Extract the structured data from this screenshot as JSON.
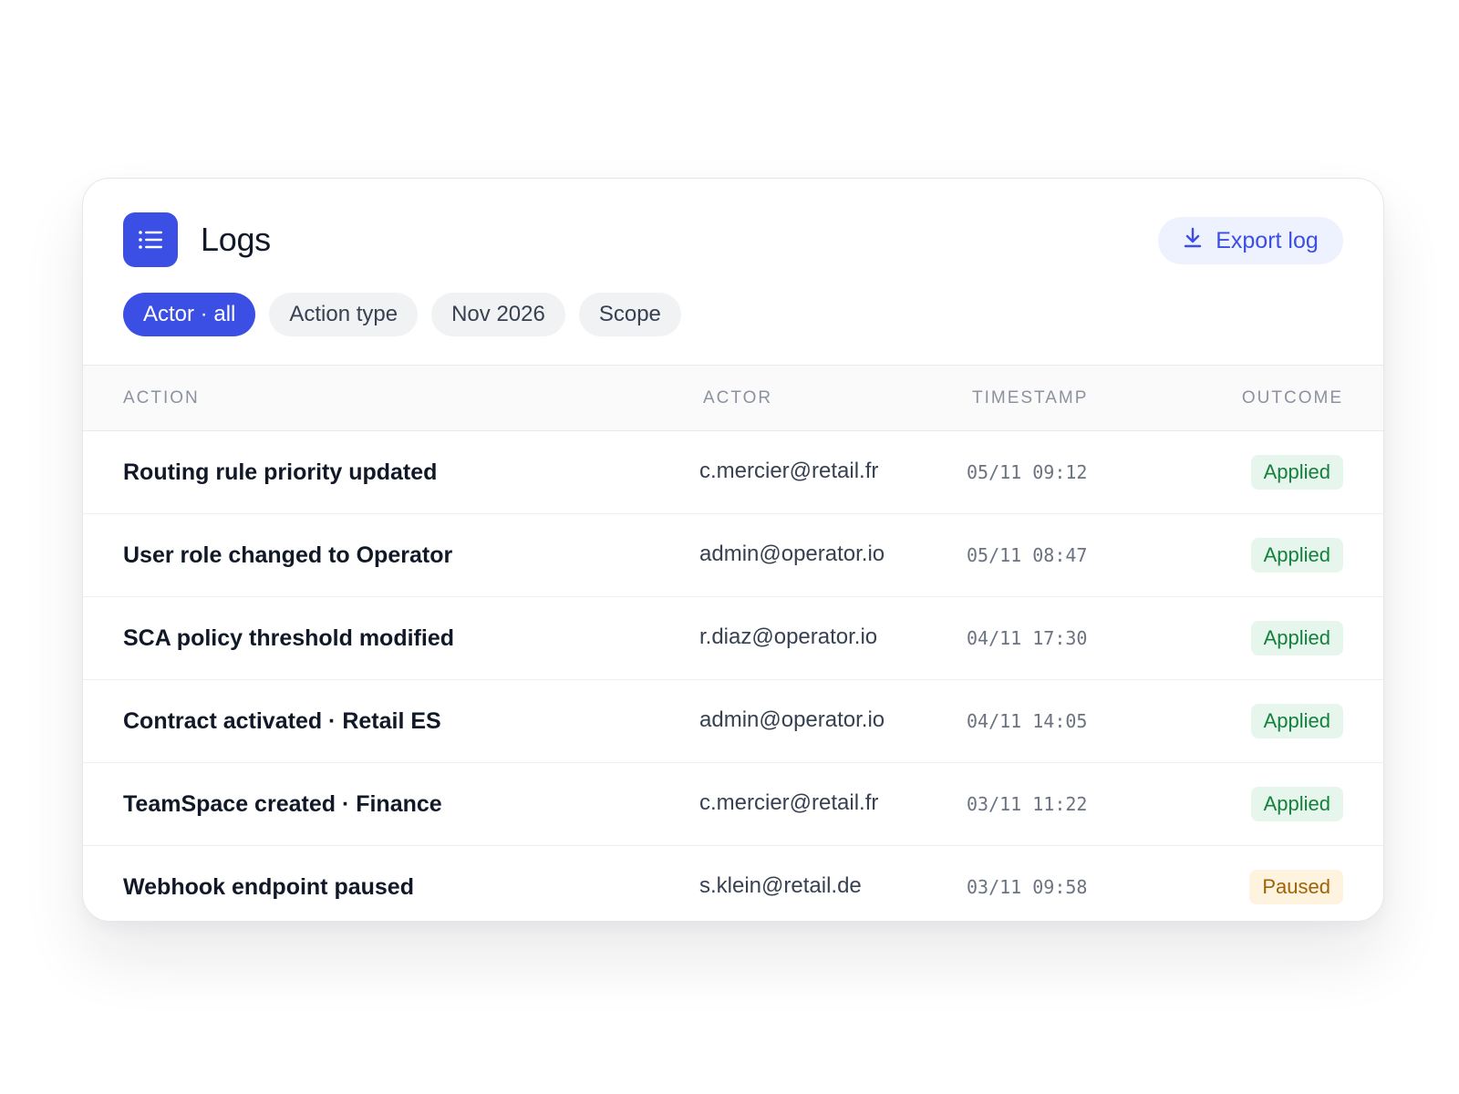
{
  "header": {
    "title": "Logs",
    "logo_icon": "list-icon",
    "export_icon": "download-icon",
    "export_label": "Export log"
  },
  "filters": [
    {
      "label": "Actor · all",
      "active": true
    },
    {
      "label": "Action type",
      "active": false
    },
    {
      "label": "Nov 2026",
      "active": false
    },
    {
      "label": "Scope",
      "active": false
    }
  ],
  "table": {
    "columns": [
      "ACTION",
      "ACTOR",
      "TIMESTAMP",
      "OUTCOME"
    ],
    "rows": [
      {
        "action": "Routing rule priority updated",
        "actor": "c.mercier@retail.fr",
        "timestamp": "05/11 09:12",
        "outcome": "Applied"
      },
      {
        "action": "User role changed to Operator",
        "actor": "admin@operator.io",
        "timestamp": "05/11 08:47",
        "outcome": "Applied"
      },
      {
        "action": "SCA policy threshold modified",
        "actor": "r.diaz@operator.io",
        "timestamp": "04/11 17:30",
        "outcome": "Applied"
      },
      {
        "action": "Contract activated · Retail ES",
        "actor": "admin@operator.io",
        "timestamp": "04/11 14:05",
        "outcome": "Applied"
      },
      {
        "action": "TeamSpace created · Finance",
        "actor": "c.mercier@retail.fr",
        "timestamp": "03/11 11:22",
        "outcome": "Applied"
      },
      {
        "action": "Webhook endpoint paused",
        "actor": "s.klein@retail.de",
        "timestamp": "03/11 09:58",
        "outcome": "Paused"
      }
    ]
  },
  "colors": {
    "accent": "#3b4fe4",
    "applied_text": "#15803d",
    "applied_bg": "#e7f6ec",
    "paused_text": "#a16207",
    "paused_bg": "#fdf3df"
  }
}
